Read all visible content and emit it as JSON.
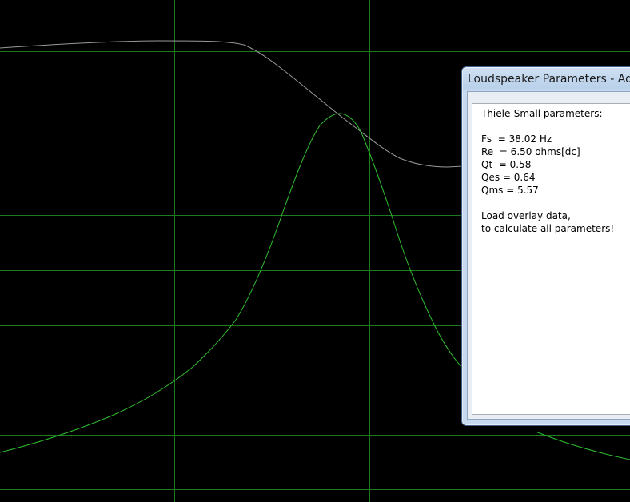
{
  "plot": {
    "background": "#000000",
    "grid_color": "#1e7a1e",
    "curve_colors": {
      "magnitude": "#9a9a9a",
      "impedance": "#2fbf2f"
    }
  },
  "dialog": {
    "title": "Loudspeaker Parameters - Added",
    "heading": "Thiele-Small parameters:",
    "params": [
      "Fs  = 38.02 Hz",
      "Re  = 6.50 ohms[dc]",
      "Qt  = 0.58",
      "Qes = 0.64",
      "Qms = 5.57"
    ],
    "note_line1": "Load overlay data,",
    "note_line2": "to calculate all parameters!"
  }
}
